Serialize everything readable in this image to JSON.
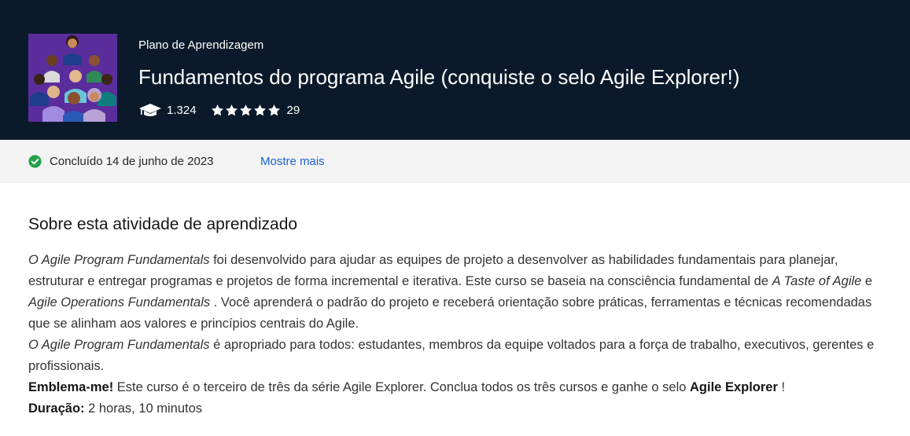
{
  "header": {
    "eyebrow": "Plano de Aprendizagem",
    "title": "Fundamentos do programa Agile (conquiste o selo Agile Explorer!)",
    "learners_count": "1.324",
    "rating_stars": 5,
    "rating_count": "29",
    "thumbnail_icon": "people-group-illustration",
    "learners_icon": "graduation-cap-icon",
    "star_icon": "star-icon"
  },
  "status": {
    "icon": "check-circle-icon",
    "text": "Concluído 14 de junho de 2023",
    "more_link": "Mostre mais"
  },
  "about": {
    "heading": "Sobre esta atividade de aprendizado",
    "p1": {
      "course_name": "O Agile Program Fundamentals",
      "text_a": " foi desenvolvido para ajudar as equipes de projeto a desenvolver as habilidades fundamentais para planejar, estruturar e entregar programas e projetos de forma incremental e iterativa. Este curso se baseia na consciência fundamental de ",
      "ref1": "A Taste of Agile",
      "text_b": " e ",
      "ref2": "Agile Operations Fundamentals",
      "text_c": " . Você aprenderá o padrão do projeto e receberá orientação sobre práticas, ferramentas e técnicas recomendadas que se alinham aos valores e princípios centrais do Agile."
    },
    "p2": {
      "course_name": "O Agile Program Fundamentals",
      "text": " é apropriado para todos: estudantes, membros da equipe voltados para a força de trabalho, executivos, gerentes e profissionais."
    },
    "p3": {
      "label": "Emblema-me!",
      "text": " Este curso é o terceiro de três da série Agile Explorer. Conclua todos os três cursos e ganhe o selo ",
      "badge": "Agile Explorer",
      "end": " !"
    },
    "p4": {
      "label": "Duração:",
      "text": " 2 horas, 10 minutos"
    }
  },
  "colors": {
    "header_bg": "#0b1a2b",
    "status_bg": "#f3f3f3",
    "link": "#1d5fd6",
    "success": "#24a148",
    "thumbnail_bg": "#5b2d9c"
  }
}
